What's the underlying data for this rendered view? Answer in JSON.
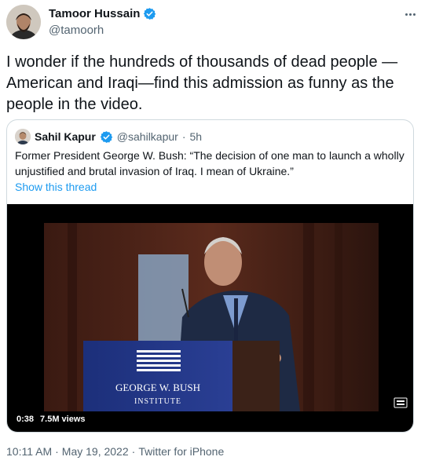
{
  "author": {
    "display_name": "Tamoor Hussain",
    "handle": "@tamoorh",
    "verified_icon": "verified-badge-icon"
  },
  "tweet": {
    "text": "I wonder if the hundreds of thousands of dead people —American and Iraqi—find this admission as funny as the people in the video."
  },
  "quoted": {
    "display_name": "Sahil Kapur",
    "handle": "@sahilkapur",
    "separator": "·",
    "time": "5h",
    "text": "Former President George W. Bush: “The decision of one man to launch a wholly unjustified and brutal invasion of Iraq. I mean of Ukraine.”",
    "thread_link": "Show this thread",
    "video": {
      "podium_line1": "GEORGE W. BUSH",
      "podium_line2": "INSTITUTE",
      "duration": "0:38",
      "views": "7.5M views"
    }
  },
  "footer": {
    "time": "10:11 AM",
    "separator1": "·",
    "date": "May 19, 2022",
    "separator2": "·",
    "source": "Twitter for iPhone"
  },
  "colors": {
    "accent": "#1d9bf0",
    "secondary_text": "#536471",
    "border": "#cfd9de"
  }
}
